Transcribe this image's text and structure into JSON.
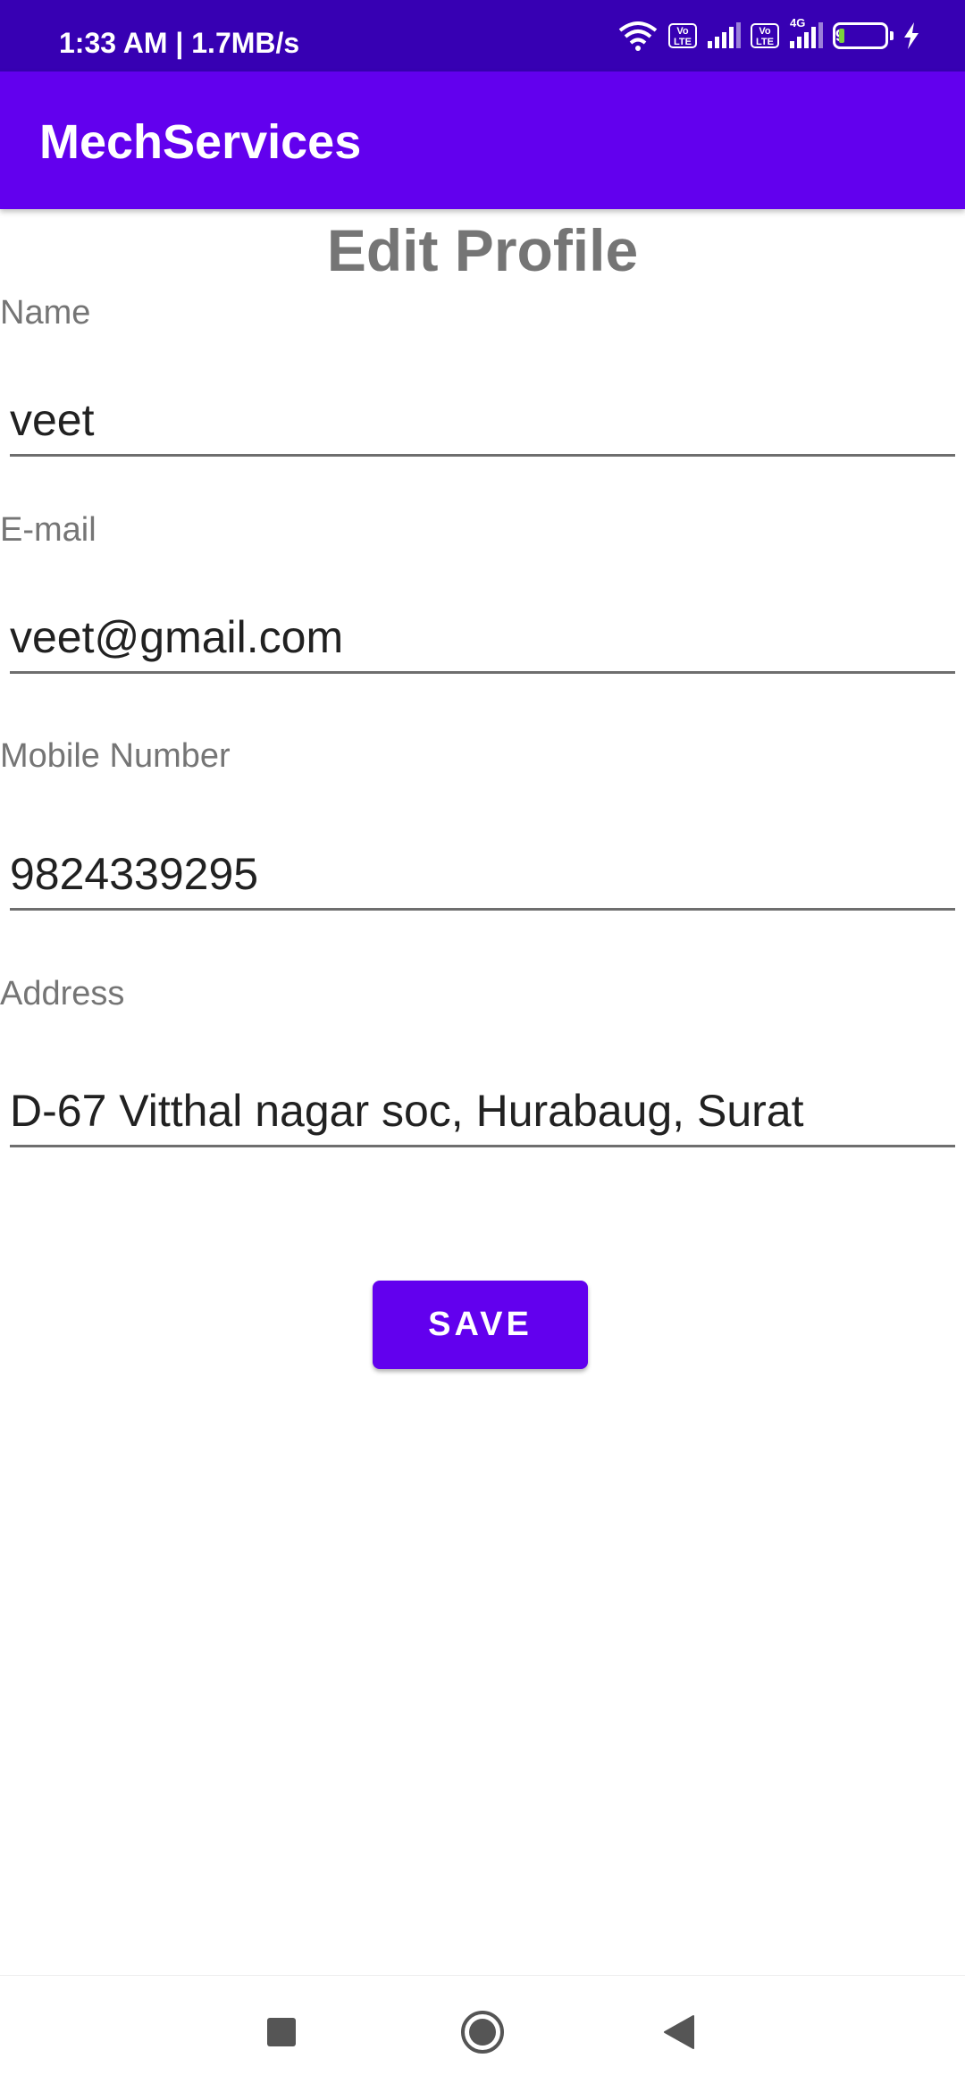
{
  "status_bar": {
    "time": "1:33 AM | 1.7MB/s",
    "battery_level": "9",
    "sim1_badge": "Vo LTE",
    "sim2_badge": "Vo LTE",
    "network_type": "4G"
  },
  "app_bar": {
    "title": "MechServices",
    "color": "#6200ee"
  },
  "page": {
    "title": "Edit Profile"
  },
  "form": {
    "name_label": "Name",
    "name_value": "veet",
    "email_label": "E-mail",
    "email_value": "veet@gmail.com",
    "mobile_label": "Mobile Number",
    "mobile_value": "9824339295",
    "address_label": "Address",
    "address_value": "D-67 Vitthal nagar soc, Hurabaug, Surat"
  },
  "actions": {
    "save_label": "SAVE"
  },
  "nav_bar": {
    "icons": [
      "square-recents-icon",
      "circle-home-icon",
      "triangle-back-icon"
    ]
  },
  "colors": {
    "primary": "#6200ee",
    "primary_dark": "#3700b3",
    "label_gray": "#757575"
  }
}
